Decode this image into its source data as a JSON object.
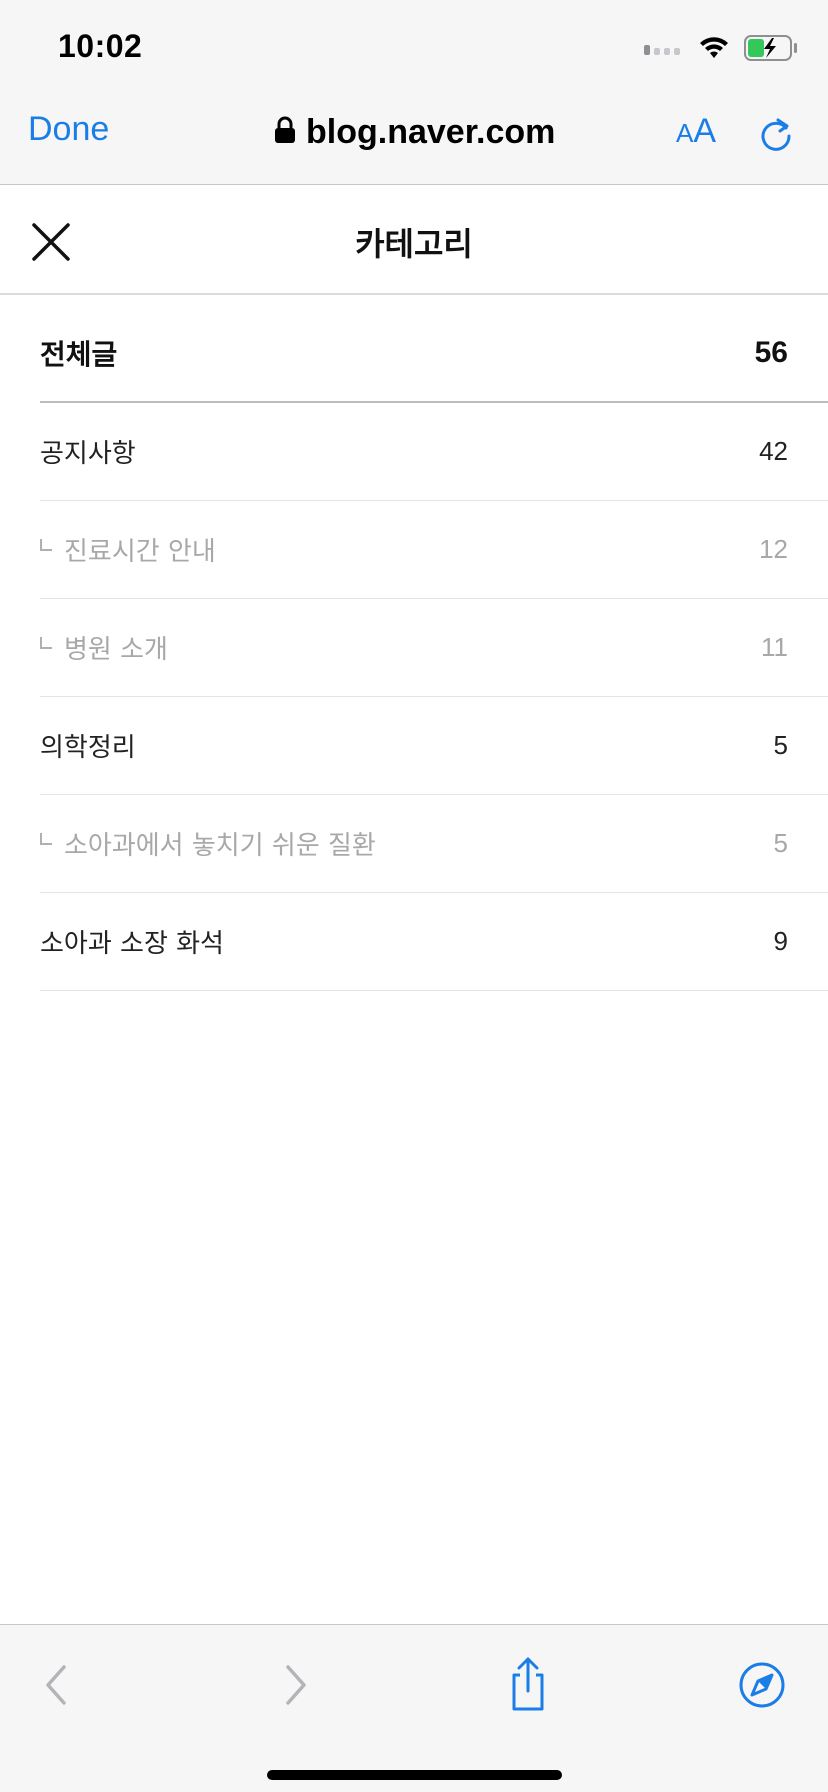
{
  "status_bar": {
    "time": "10:02",
    "icons": [
      "signal-icon",
      "wifi-icon",
      "battery-charging-icon"
    ],
    "battery_color": "#34c759"
  },
  "browser": {
    "done_label": "Done",
    "url": "blog.naver.com",
    "text_size_label_small": "A",
    "text_size_label_big": "A",
    "accent_color": "#1a7ee6"
  },
  "category_panel": {
    "title": "카테고리",
    "items": [
      {
        "name": "전체글",
        "count": "56",
        "level": "total"
      },
      {
        "name": "공지사항",
        "count": "42",
        "level": "top"
      },
      {
        "name": "진료시간 안내",
        "count": "12",
        "level": "sub"
      },
      {
        "name": "병원 소개",
        "count": "11",
        "level": "sub"
      },
      {
        "name": "의학정리",
        "count": "5",
        "level": "top"
      },
      {
        "name": "소아과에서 놓치기 쉬운 질환",
        "count": "5",
        "level": "sub"
      },
      {
        "name": "소아과 소장 화석",
        "count": "9",
        "level": "top"
      }
    ]
  },
  "toolbar": {
    "icons": [
      "back-icon",
      "forward-icon",
      "share-icon",
      "compass-icon"
    ]
  }
}
